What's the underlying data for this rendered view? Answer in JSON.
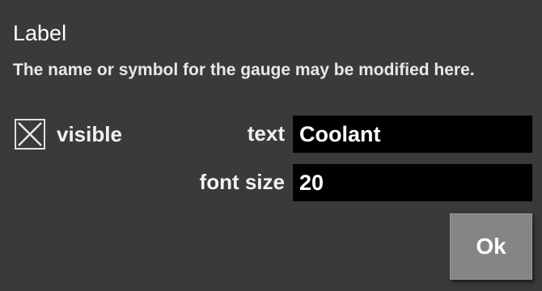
{
  "dialog": {
    "title": "Label",
    "description": "The name or symbol for the gauge may be modified here.",
    "visible": {
      "label": "visible",
      "checked": true
    },
    "text_field": {
      "label": "text",
      "value": "Coolant"
    },
    "font_size_field": {
      "label": "font size",
      "value": "20"
    },
    "ok_label": "Ok"
  },
  "colors": {
    "background": "#3a3a3a",
    "input_background": "#000000",
    "button_background": "#858585",
    "text": "#f2f2f2"
  },
  "icons": {
    "checkbox_mark": "x-mark-icon"
  }
}
